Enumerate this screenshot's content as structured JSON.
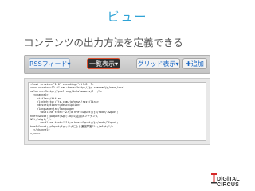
{
  "title": "ビュー",
  "subtitle": "コンテンツの出力方法を定義できる",
  "toolbar": {
    "rss_label": "RSSフィード▾",
    "list_label": "一覧表示▾",
    "grid_label": "グリッド表示▾",
    "add_label": "✚追加"
  },
  "code": {
    "lines": [
      "<?xml version=\"1.0\" encoding=\"utf-8\" ?>",
      "<rss version=\"2.0\" xml:base=\"http://jp.comcom/jp/news/rss\"",
      "xmlns:dc=\"http://purl.org/dc/elements/1.1/\">",
      "  <channel>",
      "    <title></title>",
      "    <link>http://jp.com/jp/news/rss</link>",
      "    <description></description>",
      "    <language>ja</language>",
      "",
      "      <outline text=\"&lt;a href=&quot;/jp/node/1&quot;",
      "href=&quot;jp&quot;&gt;10月の定期メンテナンス",
      "&lt;/a&gt;\"/>",
      "      <outline text=\"&lt;a href=&quot;/jp/node/2&quot;",
      "href=&quot;jp&quot;&gt;テナによる通信障害&lt;/a&gt;\"/>",
      "",
      "  </channel>",
      "</rss>"
    ]
  },
  "logo": {
    "text": "DiGiTAL CIRCUS"
  }
}
